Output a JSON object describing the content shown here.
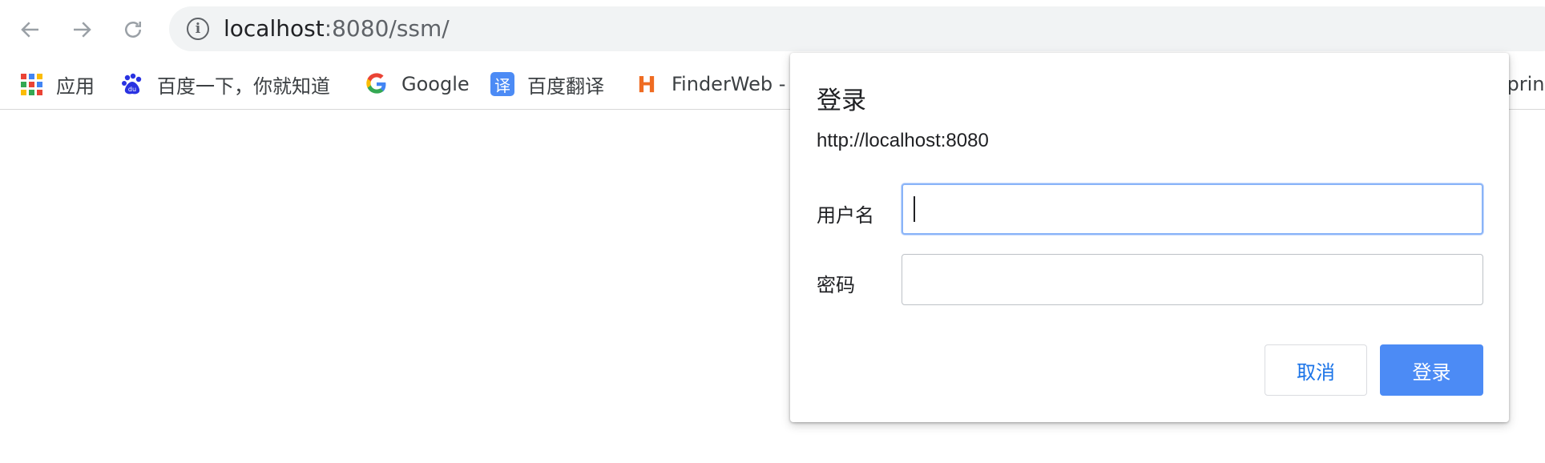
{
  "toolbar": {
    "back_icon": "arrow-left-icon",
    "forward_icon": "arrow-right-icon",
    "reload_icon": "reload-icon",
    "url_host": "localhost",
    "url_rest": ":8080/ssm/"
  },
  "bookmarks": [
    {
      "label": "应用",
      "icon": "apps-grid-icon"
    },
    {
      "label": "百度一下，你就知道",
      "icon": "baidu-paw-icon"
    },
    {
      "label": "Google",
      "icon": "google-g-icon"
    },
    {
      "label": "百度翻译",
      "icon": "translate-icon",
      "icon_text": "译"
    },
    {
      "label": "FinderWeb - F",
      "icon": "finderweb-h-icon",
      "icon_text": "H"
    },
    {
      "label": "sprin"
    }
  ],
  "dialog": {
    "title": "登录",
    "origin": "http://localhost:8080",
    "username_label": "用户名",
    "username_value": "",
    "password_label": "密码",
    "password_value": "",
    "cancel_label": "取消",
    "login_label": "登录"
  },
  "colors": {
    "accent": "#4c8bf5",
    "link": "#1a73e8",
    "focus_ring": "#8ab4f8"
  }
}
